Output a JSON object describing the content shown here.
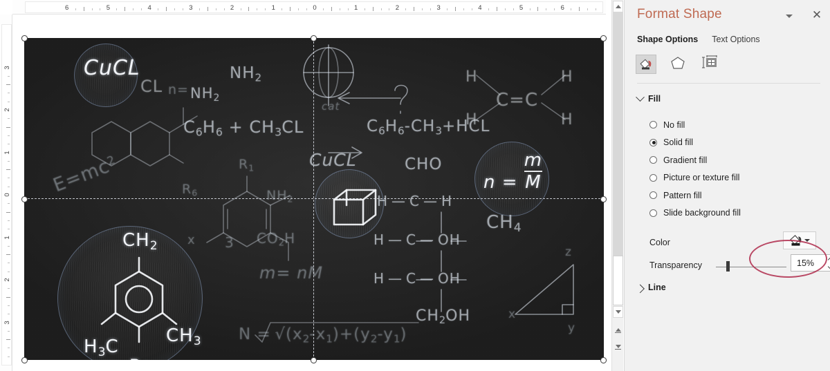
{
  "app": {
    "rulers": {
      "horizontal_labels": [
        "6",
        "5",
        "4",
        "3",
        "2",
        "1",
        "0",
        "1",
        "2",
        "3",
        "4",
        "5",
        "6"
      ],
      "vertical_labels": [
        "3",
        "2",
        "1",
        "0",
        "1",
        "2",
        "3"
      ]
    },
    "scrollbar": {
      "up_arrow": "scroll-up-icon",
      "down_arrow": "scroll-down-icon",
      "previous_slide": "previous-slide-icon",
      "next_slide": "next-slide-icon"
    }
  },
  "slide": {
    "background_color": "#262626",
    "selected": true,
    "chalkboard": {
      "title_items": [
        {
          "text": "CuCL",
          "emphasis": "bright"
        },
        {
          "text": "CH",
          "sub": "2",
          "emphasis": "bright"
        },
        {
          "text": "n = m/M",
          "emphasis": "bright"
        }
      ],
      "formulas": [
        "CuCL",
        "CL",
        "n =",
        "NH2",
        "NH2",
        "C6H6 + CH3CL",
        "cat",
        "C6H6 - CH3 + HCL",
        "H   C = C   H",
        "H            H",
        "E = mc2",
        "R1",
        "R6",
        "NH2",
        "CuCL",
        "CHO",
        "n = M/M",
        "CH4",
        "H - C - H",
        "H - C - OH",
        "H - C - OH",
        "CH2OH",
        "CO2H",
        "3",
        "m = nM",
        "N = sqrt((x2-x1) + (y2-y1))",
        "CH2",
        "H3C",
        "CH3",
        "Br",
        "x",
        "y",
        "z"
      ]
    }
  },
  "pane": {
    "title": "Format Shape",
    "dropdown_icon": "chevron-down-icon",
    "close_icon": "close-icon",
    "tabs": [
      {
        "label": "Shape Options",
        "active": true
      },
      {
        "label": "Text Options",
        "active": false
      }
    ],
    "icon_buttons": [
      {
        "name": "fill-and-line-icon",
        "selected": true
      },
      {
        "name": "effects-icon",
        "selected": false
      },
      {
        "name": "size-and-properties-icon",
        "selected": false
      }
    ],
    "fill_section": {
      "label": "Fill",
      "expanded": true,
      "options": [
        {
          "label": "No fill",
          "selected": false
        },
        {
          "label": "Solid fill",
          "selected": true
        },
        {
          "label": "Gradient fill",
          "selected": false
        },
        {
          "label": "Picture or texture fill",
          "selected": false
        },
        {
          "label": "Pattern fill",
          "selected": false
        },
        {
          "label": "Slide background fill",
          "selected": false
        }
      ],
      "color": {
        "label": "Color",
        "swatch_color": "#1b1b1b",
        "button_icon": "fill-color-icon",
        "dropdown_icon": "chevron-down-icon"
      },
      "transparency": {
        "label": "Transparency",
        "value": "15%",
        "percent": 15
      }
    },
    "line_section": {
      "label": "Line",
      "expanded": false
    },
    "annotation": {
      "shape": "ellipse",
      "color": "#b03050"
    }
  }
}
